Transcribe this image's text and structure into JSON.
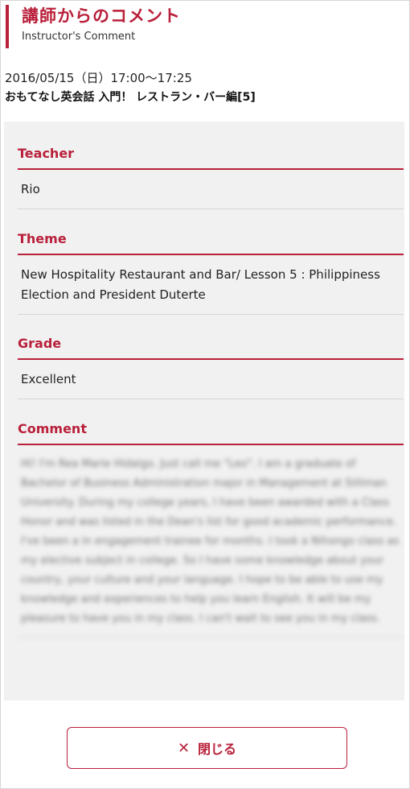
{
  "header": {
    "title": "講師からのコメント",
    "subtitle": "Instructor's Comment"
  },
  "lesson": {
    "datetime": "2016/05/15（日）17:00〜17:25",
    "course": "おもてなし英会話 入門！ レストラン・バー編[5]"
  },
  "sections": {
    "teacher": {
      "label": "Teacher",
      "value": "Rio"
    },
    "theme": {
      "label": "Theme",
      "value": "New Hospitality Restaurant and Bar/ Lesson 5 : Philippiness Election and President Duterte"
    },
    "grade": {
      "label": "Grade",
      "value": "Excellent"
    },
    "comment": {
      "label": "Comment",
      "value": "Hi! I'm Rea Marie Hidalgo. Just call me \"Leo\". I am a graduate of Bachelor of Business Administration major in Management at Silliman University. During my college years, I have been awarded with a Class Honor and was listed in the Dean's list for good academic performance. I've been a in engagement trainee for months. I took a Nihongo class as my elective subject in college. So I have some knowledge about your country, your culture and your language. I hope to be able to use my knowledge and experiences to help you learn English. It will be my pleasure to have you in my class. I can't wait to see you in my class."
    }
  },
  "close_button": {
    "icon": "close-icon",
    "label": "閉じる"
  },
  "colors": {
    "accent": "#b9203a",
    "panel": "#f1f1f1"
  }
}
